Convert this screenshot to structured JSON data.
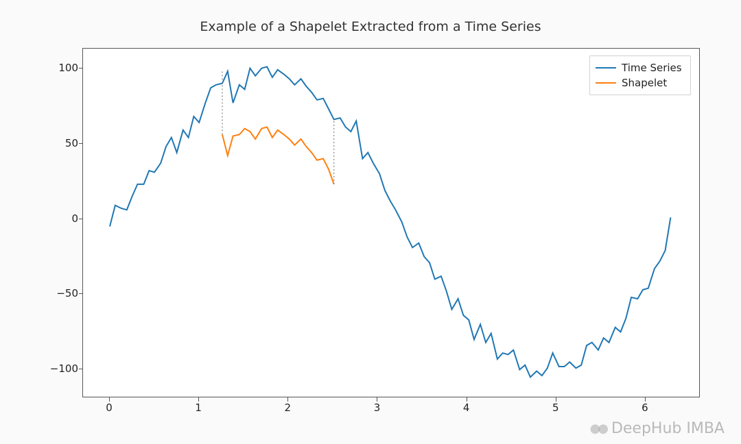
{
  "chart_data": {
    "type": "line",
    "title": "Example of a Shapelet Extracted from a Time Series",
    "xlabel": "",
    "ylabel": "",
    "xlim": [
      -0.3,
      6.6
    ],
    "ylim": [
      -118,
      113
    ],
    "xticks": [
      0,
      1,
      2,
      3,
      4,
      5,
      6
    ],
    "yticks": [
      -100,
      -50,
      0,
      50,
      100
    ],
    "xtick_labels": [
      "0",
      "1",
      "2",
      "3",
      "4",
      "5",
      "6"
    ],
    "ytick_labels": [
      "−100",
      "−50",
      "0",
      "50",
      "100"
    ],
    "legend": {
      "position": "upper right",
      "entries": [
        "Time Series",
        "Shapelet"
      ]
    },
    "colors": {
      "Time Series": "#1f77b4",
      "Shapelet": "#ff7f0e",
      "connector": "#808080"
    },
    "series": [
      {
        "name": "Time Series",
        "x": [
          0.0,
          0.06,
          0.13,
          0.19,
          0.25,
          0.31,
          0.38,
          0.44,
          0.5,
          0.57,
          0.63,
          0.69,
          0.75,
          0.82,
          0.88,
          0.94,
          1.0,
          1.07,
          1.13,
          1.19,
          1.26,
          1.32,
          1.38,
          1.45,
          1.51,
          1.57,
          1.63,
          1.7,
          1.76,
          1.82,
          1.88,
          1.95,
          2.01,
          2.07,
          2.14,
          2.2,
          2.26,
          2.32,
          2.39,
          2.45,
          2.51,
          2.58,
          2.64,
          2.7,
          2.76,
          2.83,
          2.89,
          2.95,
          3.02,
          3.08,
          3.14,
          3.2,
          3.27,
          3.33,
          3.39,
          3.46,
          3.52,
          3.58,
          3.64,
          3.71,
          3.77,
          3.83,
          3.9,
          3.96,
          4.02,
          4.08,
          4.15,
          4.21,
          4.27,
          4.34,
          4.4,
          4.46,
          4.52,
          4.59,
          4.65,
          4.71,
          4.78,
          4.84,
          4.9,
          4.96,
          5.03,
          5.09,
          5.15,
          5.22,
          5.28,
          5.34,
          5.4,
          5.47,
          5.53,
          5.59,
          5.66,
          5.72,
          5.78,
          5.84,
          5.91,
          5.97,
          6.03,
          6.1,
          6.16,
          6.22,
          6.28
        ],
        "values": [
          -5,
          9,
          7,
          6,
          15,
          23,
          23,
          32,
          31,
          37,
          48,
          54,
          44,
          59,
          54,
          68,
          64,
          77,
          87,
          89,
          90,
          98,
          77,
          89,
          86,
          100,
          95,
          100,
          101,
          94,
          99,
          96,
          93,
          89,
          93,
          88,
          84,
          79,
          80,
          73,
          66,
          67,
          61,
          58,
          65,
          40,
          44,
          37,
          30,
          19,
          12,
          6,
          -2,
          -12,
          -19,
          -16,
          -25,
          -29,
          -40,
          -38,
          -48,
          -60,
          -53,
          -64,
          -67,
          -80,
          -70,
          -82,
          -76,
          -93,
          -89,
          -90,
          -87,
          -100,
          -97,
          -105,
          -101,
          -104,
          -99,
          -89,
          -98,
          -98,
          -95,
          -99,
          -97,
          -84,
          -82,
          -87,
          -79,
          -82,
          -72,
          -75,
          -66,
          -52,
          -53,
          -47,
          -46,
          -33,
          -28,
          -21,
          1
        ]
      },
      {
        "name": "Shapelet",
        "x": [
          1.26,
          1.32,
          1.38,
          1.45,
          1.51,
          1.57,
          1.63,
          1.7,
          1.76,
          1.82,
          1.88,
          1.95,
          2.01,
          2.07,
          2.14,
          2.2,
          2.26,
          2.32,
          2.39,
          2.45,
          2.51
        ],
        "values": [
          56,
          42,
          55,
          56,
          60,
          58,
          53,
          60,
          61,
          54,
          59,
          56,
          53,
          49,
          53,
          48,
          44,
          39,
          40,
          33,
          23
        ]
      }
    ],
    "connectors": [
      {
        "x": 1.26,
        "y_from": 56,
        "y_to": 98
      },
      {
        "x": 2.51,
        "y_from": 23,
        "y_to": 66
      }
    ]
  },
  "watermark": "DeepHub IMBA"
}
